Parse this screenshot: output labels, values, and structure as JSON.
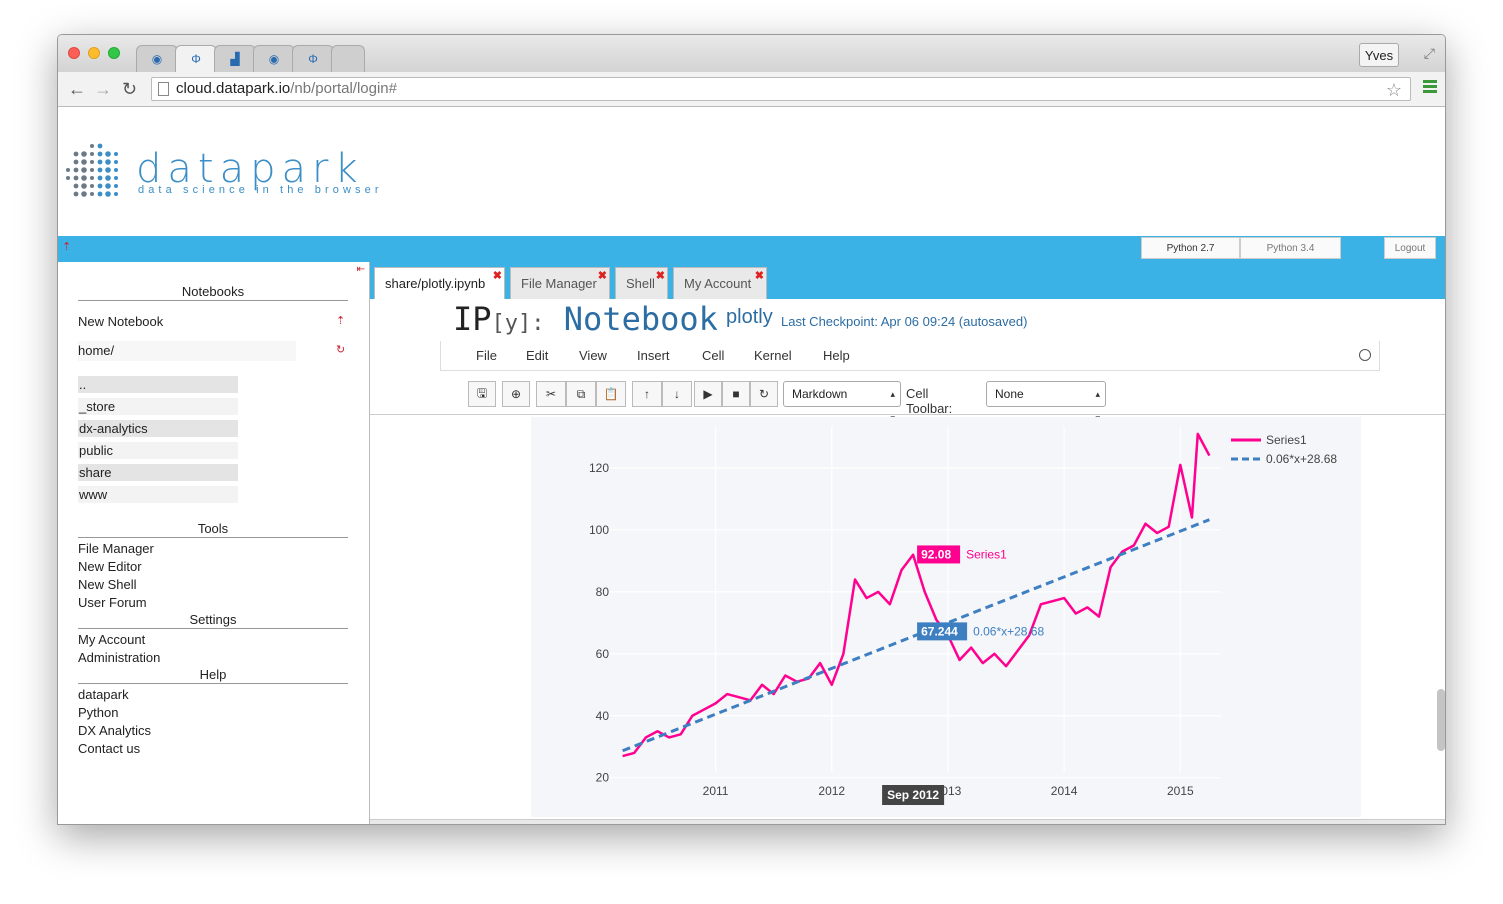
{
  "browser": {
    "user_button": "Yves",
    "url_host": "cloud.datapark.io",
    "url_path": "/nb/portal/login#"
  },
  "logo": {
    "name": "datapark",
    "tagline": "data science in the browser"
  },
  "topbar": {
    "python27": "Python 2.7",
    "python34": "Python 3.4",
    "logout": "Logout"
  },
  "sidebar": {
    "notebooks_header": "Notebooks",
    "new_notebook": "New Notebook",
    "home": "home/",
    "dirs": [
      "..",
      "_store",
      "dx-analytics",
      "public",
      "share",
      "www"
    ],
    "tools_header": "Tools",
    "tools": [
      "File Manager",
      "New Editor",
      "New Shell",
      "User Forum"
    ],
    "settings_header": "Settings",
    "settings": [
      "My Account",
      "Administration"
    ],
    "help_header": "Help",
    "help": [
      "datapark",
      "Python",
      "DX Analytics",
      "Contact us"
    ]
  },
  "tabs": [
    "share/plotly.ipynb",
    "File Manager",
    "Shell",
    "My Account"
  ],
  "notebook": {
    "logo_ip": "IP",
    "logo_y": "[y]:",
    "logo_nb": "Notebook",
    "name": "plotly",
    "checkpoint": "Last Checkpoint: Apr 06 09:24 (autosaved)",
    "menu": [
      "File",
      "Edit",
      "View",
      "Insert",
      "Cell",
      "Kernel",
      "Help"
    ],
    "cell_type": "Markdown",
    "cell_toolbar_label": "Cell Toolbar:",
    "cell_toolbar_value": "None"
  },
  "chart_data": {
    "type": "line",
    "xlabel": "",
    "ylabel": "",
    "x_ticks": [
      "2011",
      "2012",
      "2013",
      "2014",
      "2015"
    ],
    "y_ticks": [
      20,
      40,
      60,
      80,
      100,
      120
    ],
    "xlim": [
      2010.1,
      2015.35
    ],
    "ylim": [
      17,
      130
    ],
    "series": [
      {
        "name": "Series1",
        "color": "#ff0090",
        "x": [
          2010.2,
          2010.3,
          2010.4,
          2010.5,
          2010.6,
          2010.7,
          2010.8,
          2010.9,
          2011.0,
          2011.1,
          2011.2,
          2011.3,
          2011.4,
          2011.5,
          2011.6,
          2011.7,
          2011.8,
          2011.9,
          2012.0,
          2012.1,
          2012.2,
          2012.3,
          2012.4,
          2012.5,
          2012.6,
          2012.7,
          2012.8,
          2012.9,
          2013.0,
          2013.1,
          2013.2,
          2013.3,
          2013.4,
          2013.5,
          2013.6,
          2013.7,
          2013.8,
          2013.9,
          2014.0,
          2014.1,
          2014.2,
          2014.3,
          2014.4,
          2014.5,
          2014.6,
          2014.7,
          2014.8,
          2014.9,
          2015.0,
          2015.1,
          2015.15,
          2015.25
        ],
        "y": [
          27,
          28,
          33,
          35,
          33,
          34,
          40,
          42,
          44,
          47,
          46,
          45,
          50,
          47,
          53,
          51,
          52,
          57,
          50,
          60,
          84,
          78,
          80,
          76,
          87,
          92,
          80,
          71,
          66,
          58,
          62,
          57,
          60,
          56,
          61,
          66,
          76,
          77,
          78,
          73,
          75,
          72,
          88,
          93,
          95,
          102,
          99,
          101,
          121,
          104,
          131,
          124
        ]
      },
      {
        "name": "0.06*x+28.68",
        "color": "#3d7fc1",
        "dash": true,
        "x": [
          2010.2,
          2015.25
        ],
        "y": [
          28.7,
          103.3
        ]
      }
    ],
    "hover_labels": [
      {
        "text": "92.08",
        "series": "Series1",
        "x": 2012.7,
        "y": 92.08
      },
      {
        "text": "67.244",
        "series": "0.06*x+28.68",
        "x": 2012.7,
        "y": 67.244
      }
    ],
    "x_hover": {
      "text": "Sep 2012",
      "x": 2012.7
    },
    "legend": "top-right"
  }
}
